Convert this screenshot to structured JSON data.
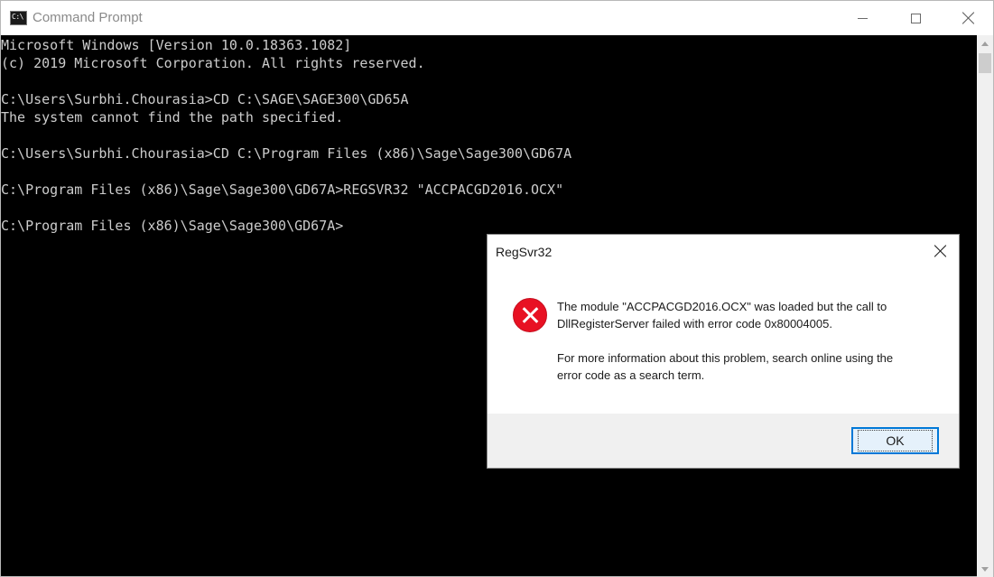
{
  "window": {
    "title": "Command Prompt",
    "icon": "C:\\",
    "icon_name": "console-app-icon"
  },
  "console": {
    "lines": [
      "Microsoft Windows [Version 10.0.18363.1082]",
      "(c) 2019 Microsoft Corporation. All rights reserved.",
      "",
      "C:\\Users\\Surbhi.Chourasia>CD C:\\SAGE\\SAGE300\\GD65A",
      "The system cannot find the path specified.",
      "",
      "C:\\Users\\Surbhi.Chourasia>CD C:\\Program Files (x86)\\Sage\\Sage300\\GD67A",
      "",
      "C:\\Program Files (x86)\\Sage\\Sage300\\GD67A>REGSVR32 \"ACCPACGD2016.OCX\"",
      "",
      "C:\\Program Files (x86)\\Sage\\Sage300\\GD67A>"
    ]
  },
  "dialog": {
    "title": "RegSvr32",
    "message_line1": "The module \"ACCPACGD2016.OCX\" was loaded but the call to",
    "message_line2": "DllRegisterServer failed with error code 0x80004005.",
    "message_line3": "For more information about this problem, search online using the",
    "message_line4": "error code as a search term.",
    "ok_label": "OK",
    "icon_name": "error-icon"
  },
  "colors": {
    "console_bg": "#000000",
    "console_text": "#cccccc",
    "error_red": "#e81123",
    "focus_blue": "#0078d7"
  }
}
